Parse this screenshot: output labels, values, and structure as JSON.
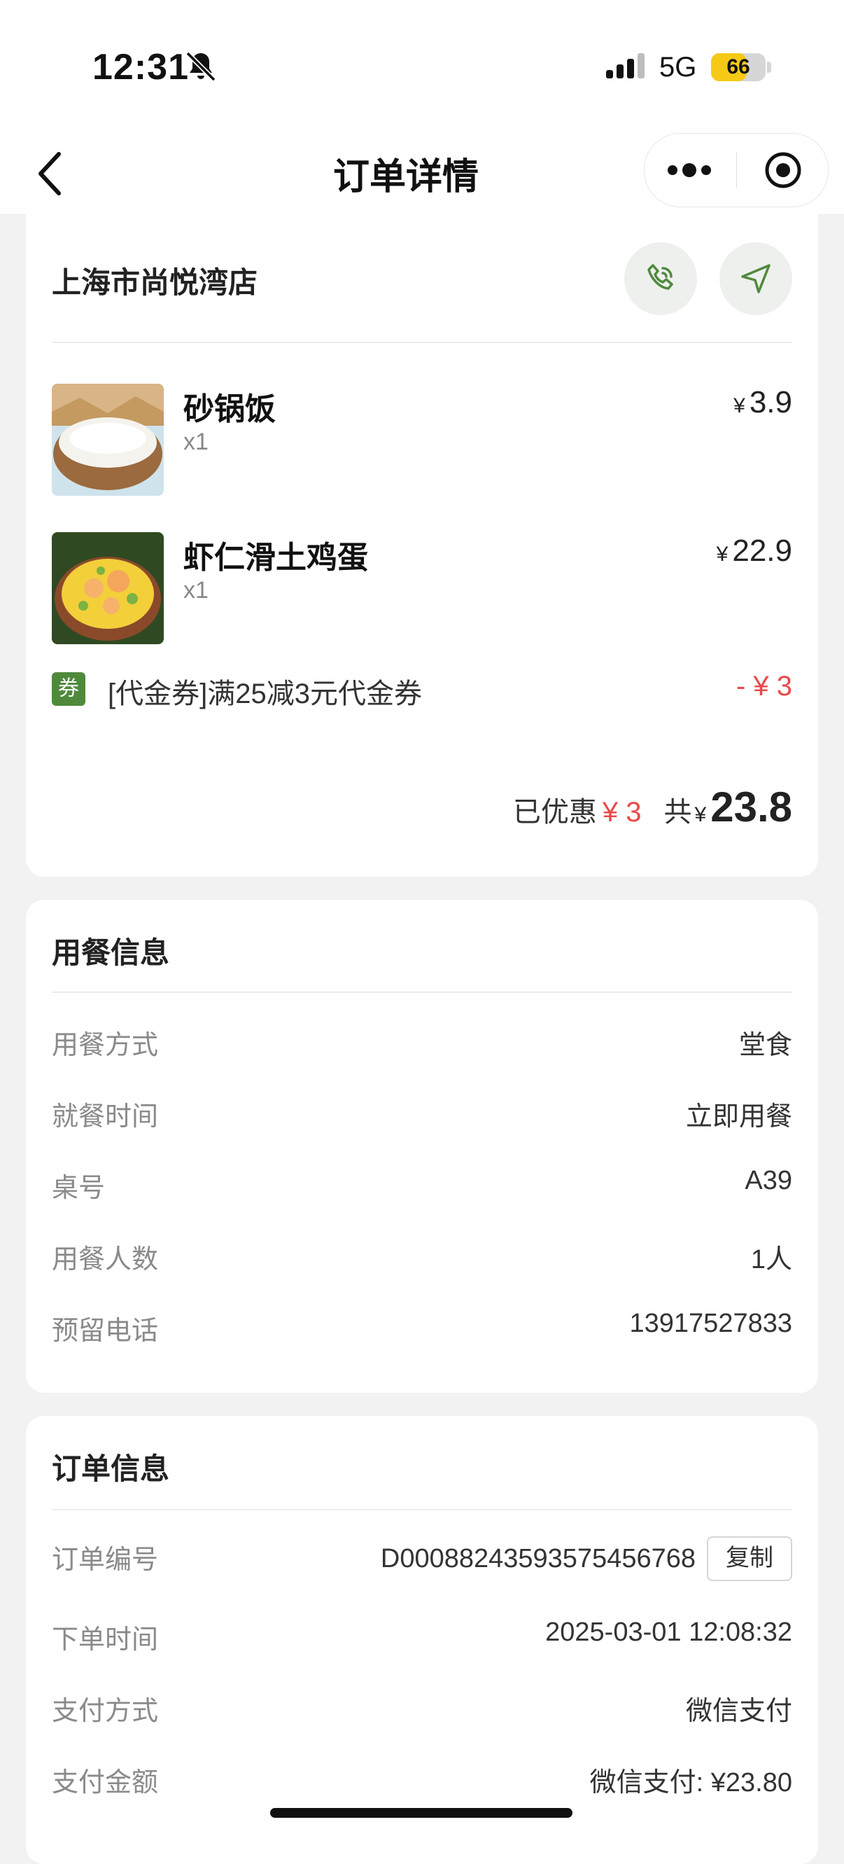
{
  "status_bar": {
    "time": "12:31",
    "network": "5G",
    "battery": "66",
    "battery_level_pct": 66,
    "accent_battery": "#f6c916"
  },
  "nav": {
    "title": "订单详情",
    "icons": [
      "back-arrow-icon",
      "more-dots-icon",
      "close-target-icon"
    ]
  },
  "order_card": {
    "store_name": "上海市尚悦湾店",
    "actions": [
      "phone-icon",
      "navigate-icon"
    ],
    "items": [
      {
        "name": "砂锅饭",
        "qty": "x1",
        "yen": "¥",
        "price": "3.9"
      },
      {
        "name": "虾仁滑土鸡蛋",
        "qty": "x1",
        "yen": "¥",
        "price": "22.9"
      }
    ],
    "coupon": {
      "tag": "券",
      "text": "[代金券]满25减3元代金券",
      "amount": "- ¥ 3"
    },
    "discount_label": "已优惠",
    "discount_amount": "¥ 3",
    "total_label": "共",
    "total_yen": "¥",
    "total_amount": "23.8"
  },
  "dining_info": {
    "title": "用餐信息",
    "rows": [
      {
        "label": "用餐方式",
        "value": "堂食"
      },
      {
        "label": "就餐时间",
        "value": "立即用餐"
      },
      {
        "label": "桌号",
        "value": "A39"
      },
      {
        "label": "用餐人数",
        "value": "1人"
      },
      {
        "label": "预留电话",
        "value": "13917527833"
      }
    ]
  },
  "order_info": {
    "title": "订单信息",
    "order_no_label": "订单编号",
    "order_no": "D00088243593575456768",
    "copy_label": "复制",
    "rows": [
      {
        "label": "下单时间",
        "value": "2025-03-01 12:08:32"
      },
      {
        "label": "支付方式",
        "value": "微信支付"
      },
      {
        "label": "支付金额",
        "value": "微信支付: ¥23.80"
      }
    ]
  },
  "colors": {
    "accent_green": "#4f8a3c",
    "discount_red": "#e94a4a",
    "page_bg": "#f2f2f2"
  }
}
